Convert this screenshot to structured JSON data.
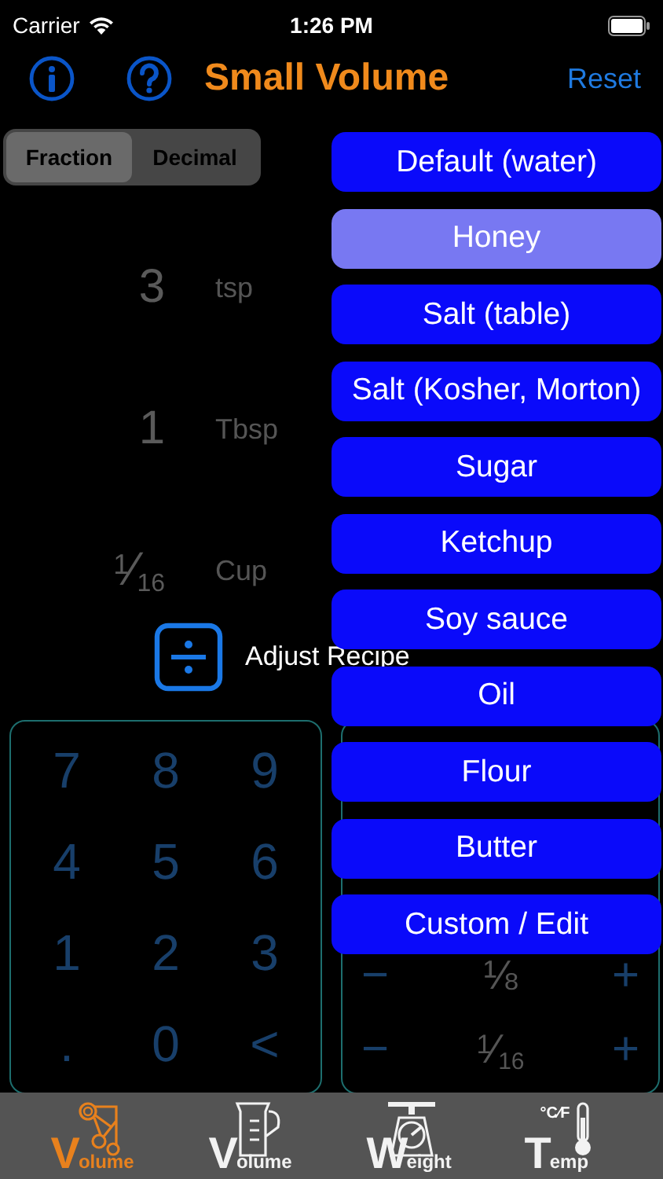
{
  "status_bar": {
    "carrier": "Carrier",
    "time": "1:26 PM"
  },
  "header": {
    "title": "Small Volume",
    "reset": "Reset"
  },
  "format_toggle": [
    {
      "label": "Fraction",
      "selected": true
    },
    {
      "label": "Decimal",
      "selected": false
    }
  ],
  "amounts": [
    {
      "value": "3",
      "unit": "tsp"
    },
    {
      "value": "1",
      "unit": "Tbsp"
    },
    {
      "value": "$^{1}$⁄$_{16}$",
      "unit": "Cup"
    }
  ],
  "adjust": {
    "label": "Adjust Recipe"
  },
  "keypad": [
    "7",
    "8",
    "9",
    "4",
    "5",
    "6",
    "1",
    "2",
    "3",
    ".",
    "0",
    "<"
  ],
  "fraction_steps": [
    {
      "minus": "−",
      "value": "⅛",
      "plus": "+"
    },
    {
      "minus": "−",
      "value": "$^{1}$⁄$_{16}$",
      "plus": "+"
    }
  ],
  "ingredient_menu": [
    {
      "label": "Default (water)",
      "selected": false
    },
    {
      "label": "Honey",
      "selected": true
    },
    {
      "label": "Salt (table)",
      "selected": false
    },
    {
      "label": "Salt (Kosher, Morton)",
      "selected": false
    },
    {
      "label": "Sugar",
      "selected": false
    },
    {
      "label": "Ketchup",
      "selected": false
    },
    {
      "label": "Soy sauce",
      "selected": false
    },
    {
      "label": "Oil",
      "selected": false
    },
    {
      "label": "Flour",
      "selected": false
    },
    {
      "label": "Butter",
      "selected": false
    },
    {
      "label": "Custom / Edit",
      "selected": false
    }
  ],
  "tab_bar": [
    {
      "kind": "spoons",
      "label": "Volume",
      "selected": true
    },
    {
      "kind": "cup",
      "label": "Volume",
      "selected": false
    },
    {
      "kind": "scale",
      "label": "Weight",
      "selected": false
    },
    {
      "kind": "thermometer",
      "label": "Temp",
      "badge": "°C⁄F",
      "selected": false
    }
  ]
}
